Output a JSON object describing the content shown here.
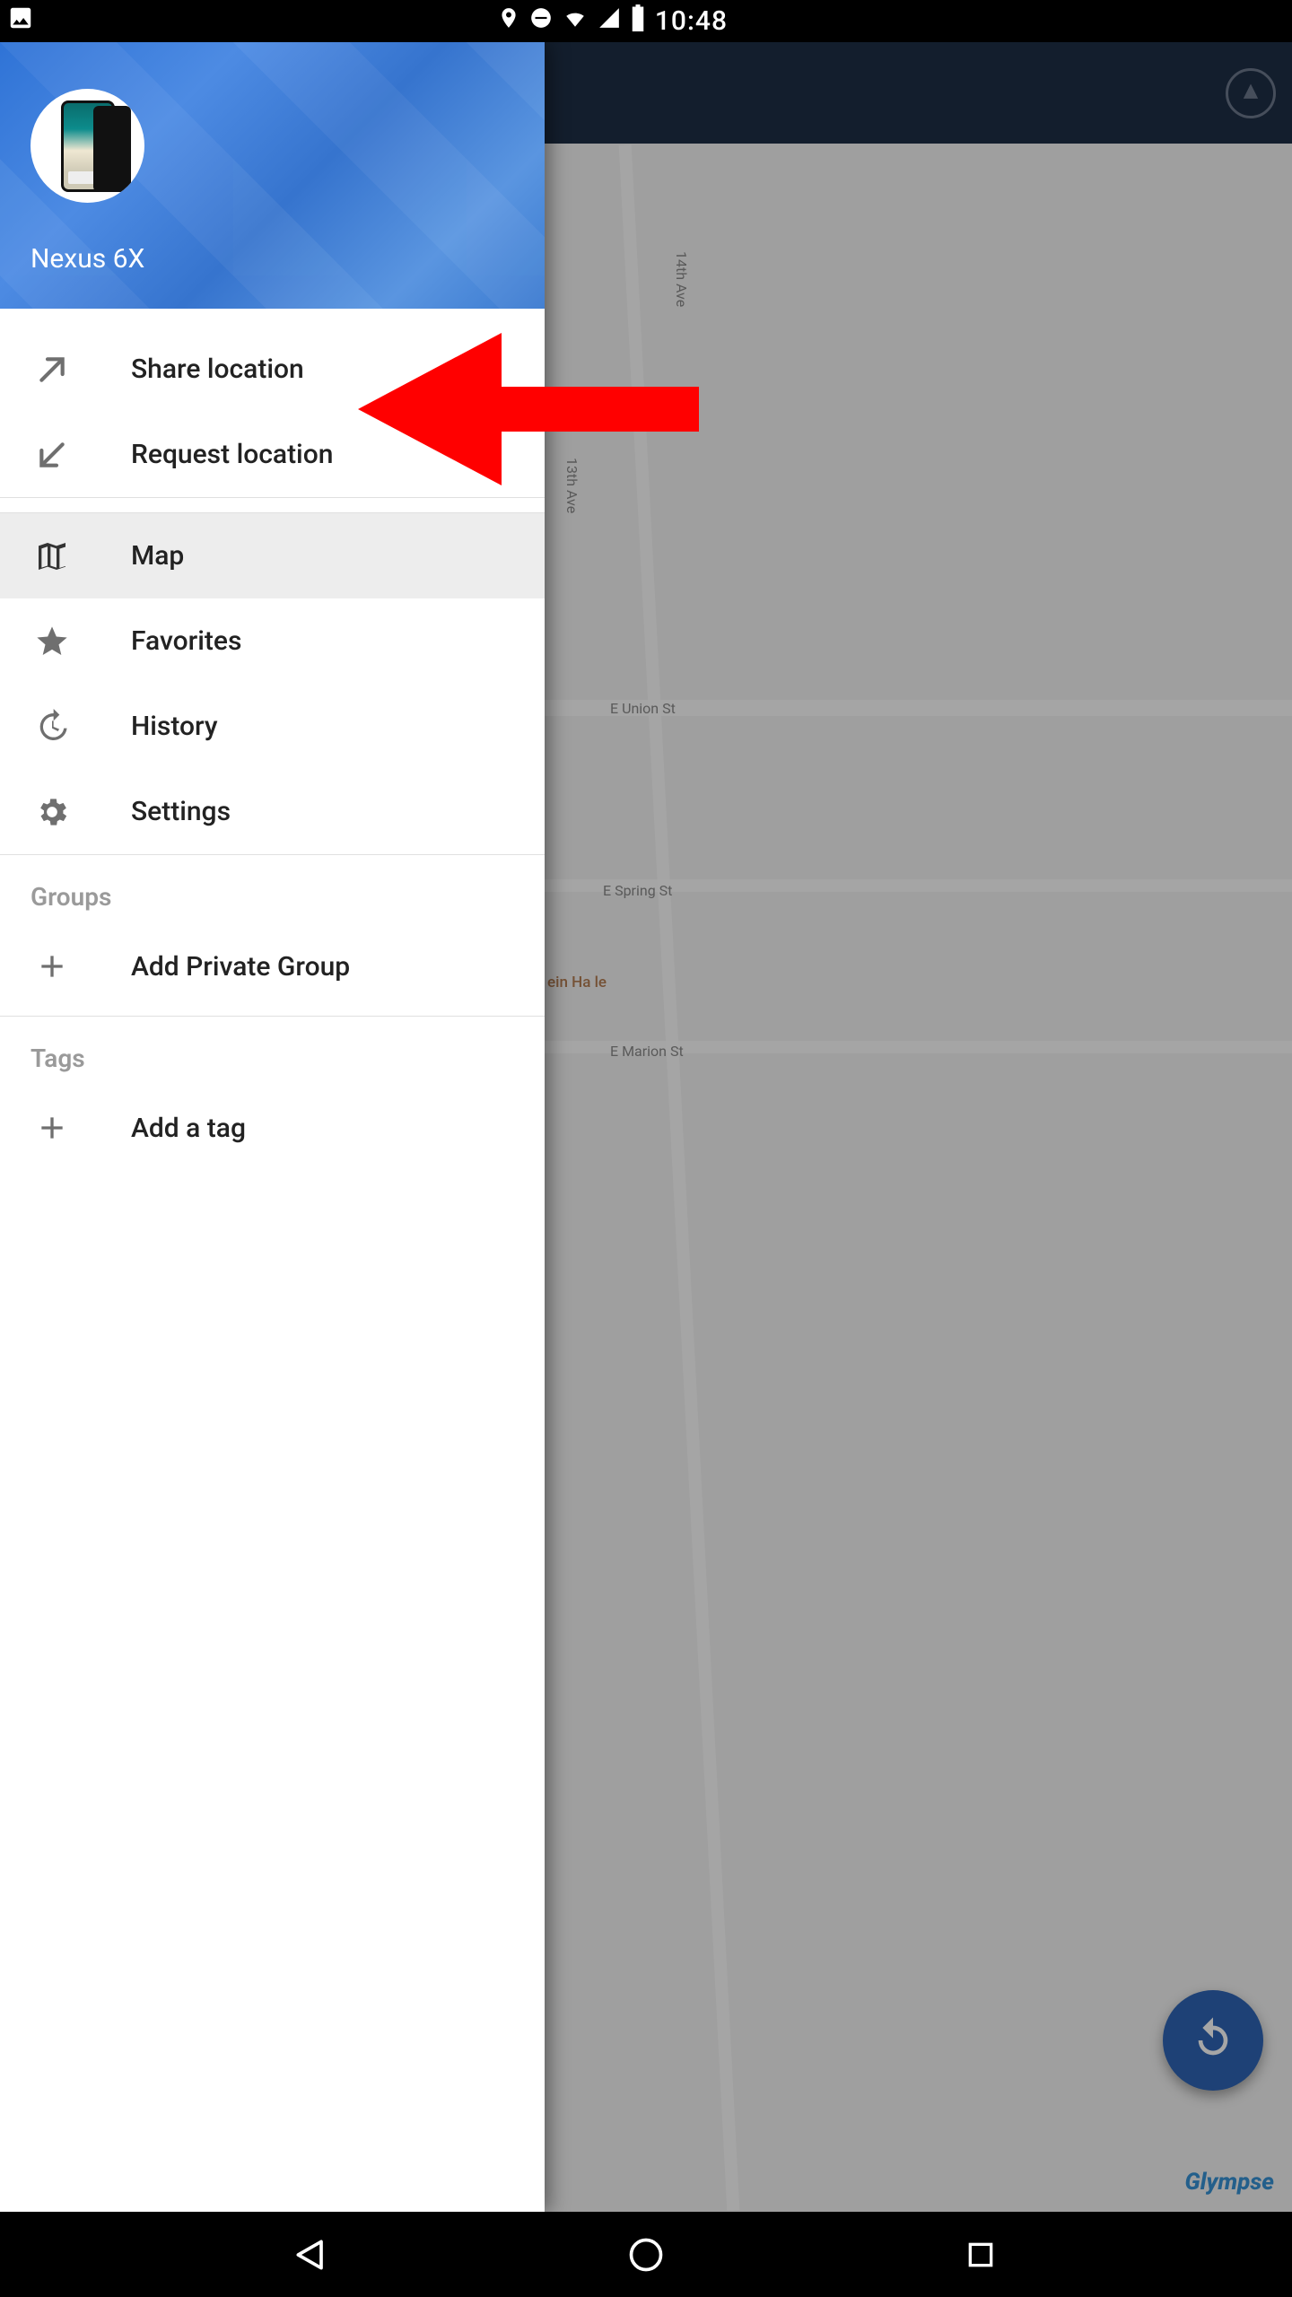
{
  "status": {
    "time": "10:48"
  },
  "drawer": {
    "device_name": "Nexus 6X",
    "items": {
      "share_location": "Share location",
      "request_location": "Request location",
      "map": "Map",
      "favorites": "Favorites",
      "history": "History",
      "settings": "Settings",
      "add_private_group": "Add Private Group",
      "add_tag": "Add a tag"
    },
    "sections": {
      "groups": "Groups",
      "tags": "Tags"
    }
  },
  "map": {
    "street_14th": "14th Ave",
    "street_13th": "13th Ave",
    "union": "E Union St",
    "spring": "E Spring St",
    "marion": "E Marion St",
    "poi": "ein Ha      le",
    "brand": "Glympse"
  }
}
